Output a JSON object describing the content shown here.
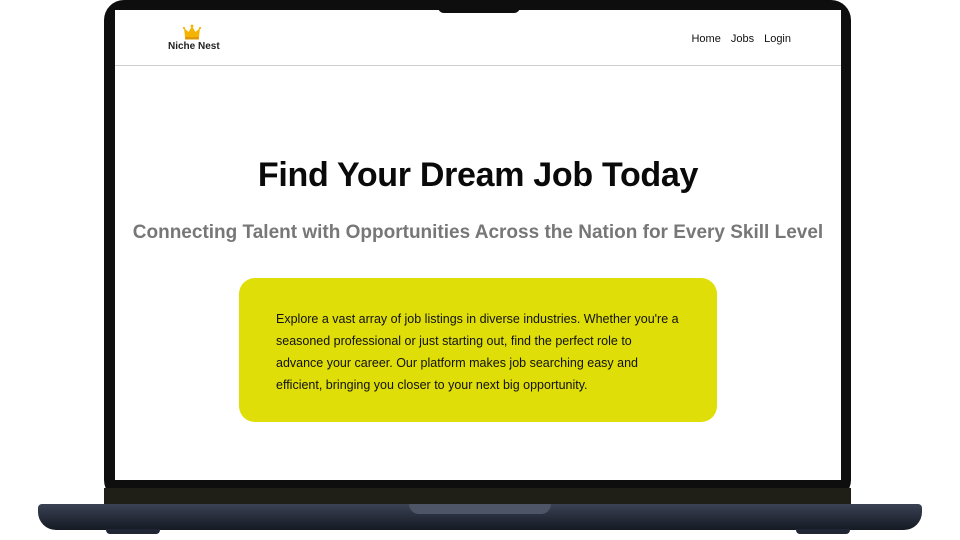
{
  "brand": {
    "name": "Niche Nest",
    "icon": "crown-icon",
    "color": "#f5b301"
  },
  "nav": {
    "home": "Home",
    "jobs": "Jobs",
    "login": "Login"
  },
  "hero": {
    "title": "Find Your Dream Job Today",
    "subtitle": "Connecting Talent with Opportunities Across the Nation for Every Skill Level"
  },
  "info": {
    "text": "Explore a vast array of job listings in diverse industries. Whether you're a seasoned professional or just starting out, find the perfect role to advance your career. Our platform makes job searching easy and efficient, bringing you closer to your next big opportunity.",
    "background": "#dfde08"
  }
}
